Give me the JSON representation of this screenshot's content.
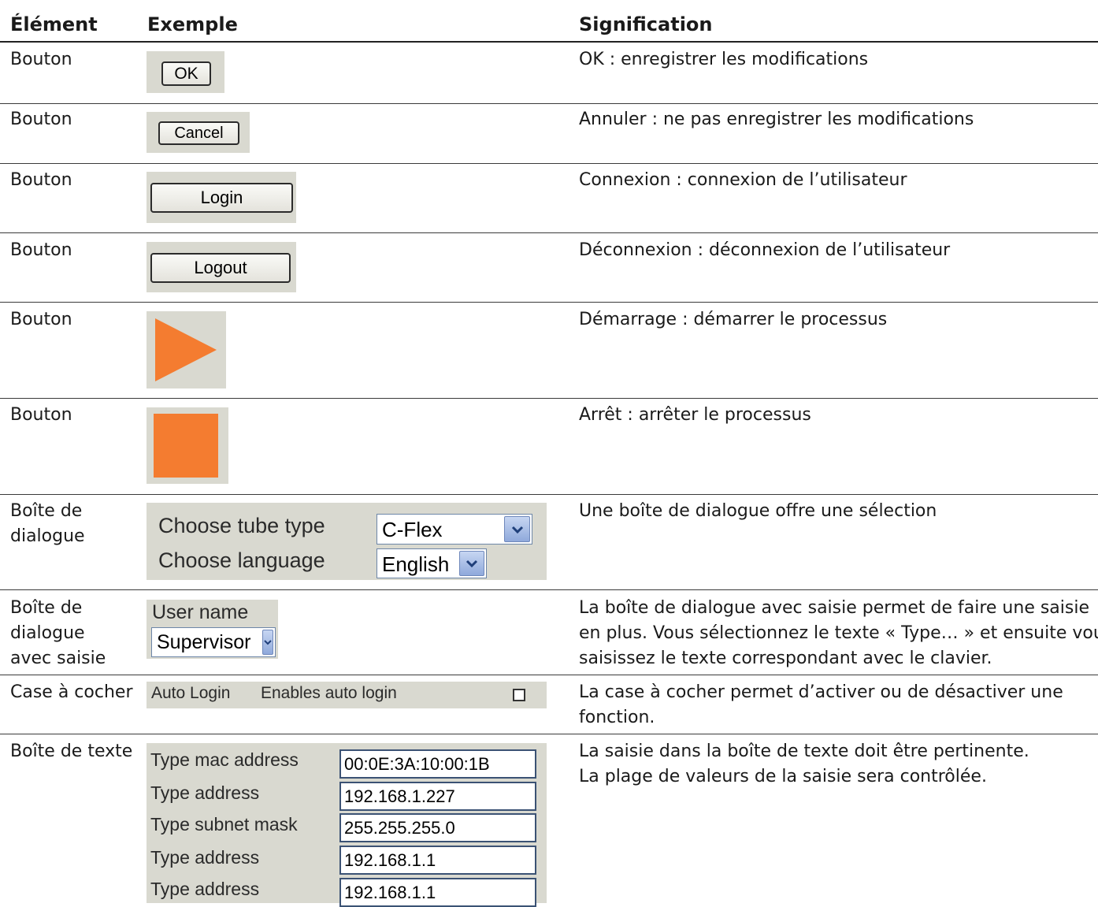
{
  "headers": {
    "element": "Élément",
    "example": "Exemple",
    "meaning": "Signification"
  },
  "rows": [
    {
      "element": "Bouton",
      "meaning": "OK : enregistrer les modifications",
      "button_label": "OK"
    },
    {
      "element": "Bouton",
      "meaning": "Annuler : ne pas enregistrer les modifications",
      "button_label": "Cancel"
    },
    {
      "element": "Bouton",
      "meaning": "Connexion : connexion de l’utilisateur",
      "button_label": "Login"
    },
    {
      "element": "Bouton",
      "meaning": "Déconnexion : déconnexion de l’utilisateur",
      "button_label": "Logout"
    },
    {
      "element": "Bouton",
      "meaning": "Démarrage : démarrer le processus",
      "icon": "play-icon",
      "icon_color": "#f47c30"
    },
    {
      "element": "Bouton",
      "meaning": "Arrêt : arrêter le processus",
      "icon": "stop-icon",
      "icon_color": "#f47c30"
    },
    {
      "element_lines": [
        "Boîte de",
        "dialogue"
      ],
      "meaning": "Une boîte de dialogue offre une sélection",
      "tube_label": "Choose tube type",
      "tube_value": "C-Flex",
      "language_label": "Choose language",
      "language_value": "English"
    },
    {
      "element_lines": [
        "Boîte de",
        "dialogue",
        "avec saisie"
      ],
      "meaning_lines": [
        "La boîte de dialogue avec saisie permet de faire une saisie",
        "en plus. Vous sélectionnez le texte « Type… » et ensuite vous",
        "saisissez le texte correspondant avec le clavier."
      ],
      "user_label": "User name",
      "user_value": "Supervisor"
    },
    {
      "element": "Case à cocher",
      "meaning_lines": [
        "La case à cocher permet d’activer ou de désactiver une",
        "fonction."
      ],
      "option_name": "Auto Login",
      "option_desc": "Enables auto login",
      "checked": false
    },
    {
      "element": "Boîte de texte",
      "meaning_lines": [
        "La saisie dans la boîte de texte doit être pertinente.",
        "La plage de valeurs de la saisie sera contrôlée."
      ],
      "fields": [
        {
          "label": "Type mac address",
          "value": "00:0E:3A:10:00:1B"
        },
        {
          "label": "Type address",
          "value": "192.168.1.227"
        },
        {
          "label": "Type subnet mask",
          "value": "255.255.255.0"
        },
        {
          "label": "Type address",
          "value": "192.168.1.1"
        },
        {
          "label": "Type address",
          "value": "192.168.1.1"
        }
      ]
    }
  ]
}
